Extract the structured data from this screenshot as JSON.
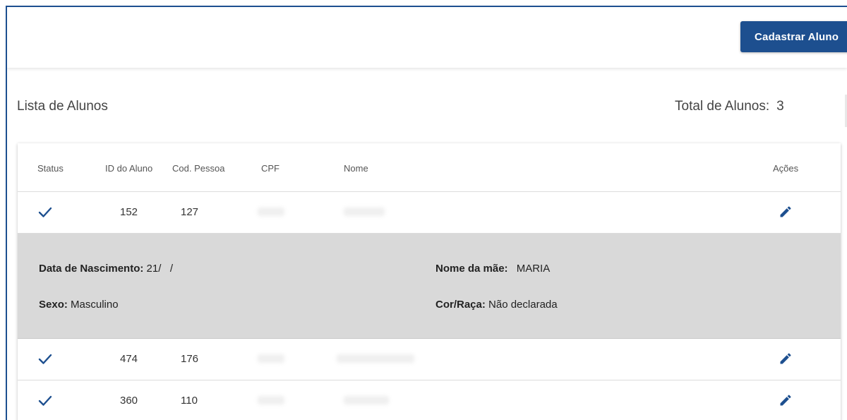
{
  "toolbar": {
    "register_button_label": "Cadastrar Aluno"
  },
  "list": {
    "title": "Lista de Alunos",
    "total_label": "Total de Alunos:",
    "total_count": "3"
  },
  "table": {
    "headers": {
      "status": "Status",
      "student_id": "ID do Aluno",
      "person_code": "Cod. Pessoa",
      "cpf": "CPF",
      "name": "Nome",
      "actions": "Ações"
    },
    "rows": [
      {
        "status_icon": "check-icon",
        "student_id": "152",
        "person_code": "127",
        "action_icon": "pencil-edit-icon"
      },
      {
        "status_icon": "check-icon",
        "student_id": "474",
        "person_code": "176",
        "action_icon": "pencil-edit-icon"
      },
      {
        "status_icon": "check-icon",
        "student_id": "360",
        "person_code": "110",
        "action_icon": "pencil-edit-icon"
      }
    ]
  },
  "detail": {
    "birth_label": "Data de Nascimento:",
    "birth_value": "21/   /",
    "mother_label": "Nome da mãe:",
    "mother_value": "MARIA",
    "sex_label": "Sexo:",
    "sex_value": "Masculino",
    "race_label": "Cor/Raça:",
    "race_value": "Não declarada"
  },
  "colors": {
    "primary": "#1d4f8f",
    "detail_background": "#d9d9d9"
  }
}
